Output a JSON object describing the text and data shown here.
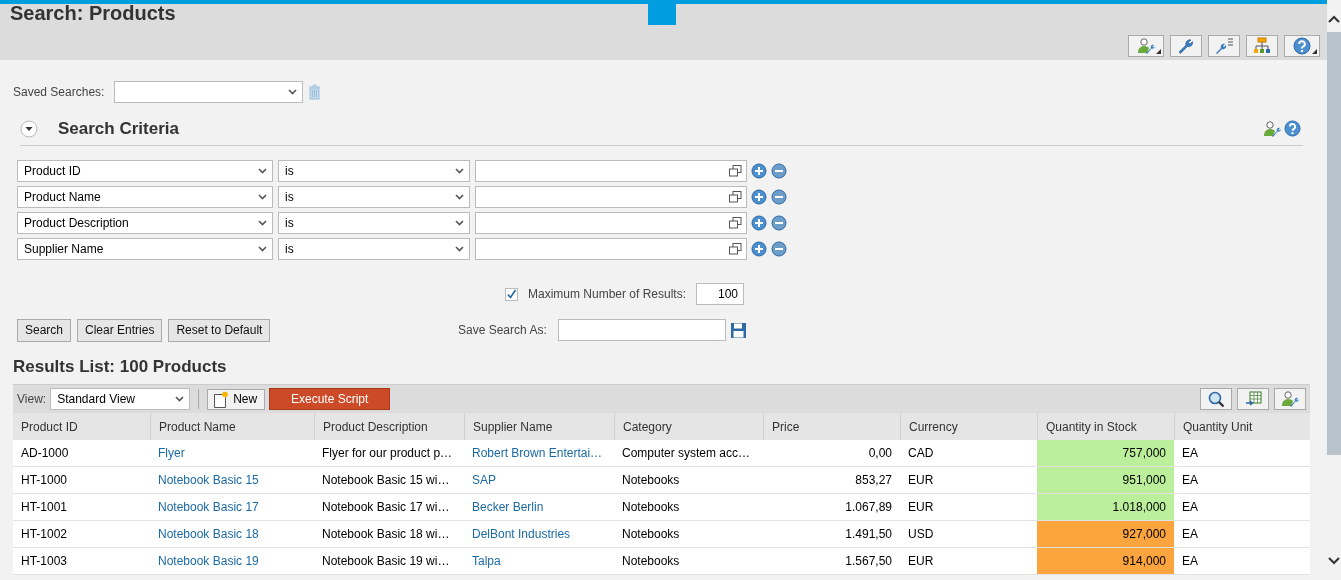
{
  "header": {
    "title": "Search: Products"
  },
  "saved_searches": {
    "label": "Saved Searches:"
  },
  "criteria": {
    "title": "Search Criteria",
    "expanded": true,
    "rows": [
      {
        "field": "Product ID",
        "operator": "is"
      },
      {
        "field": "Product Name",
        "operator": "is"
      },
      {
        "field": "Product Description",
        "operator": "is"
      },
      {
        "field": "Supplier Name",
        "operator": "is"
      }
    ]
  },
  "max_results": {
    "checked": true,
    "label": "Maximum Number of Results:",
    "value": "100"
  },
  "buttons": [
    "Search",
    "Clear Entries",
    "Reset to Default"
  ],
  "save_search": {
    "label": "Save Search As:"
  },
  "results": {
    "title": "Results List: 100 Products",
    "view_label": "View:",
    "view": "Standard View",
    "new_button": "New",
    "script_button": "Execute Script",
    "columns": [
      {
        "label": "Product ID",
        "kind": "text"
      },
      {
        "label": "Product Name",
        "kind": "link"
      },
      {
        "label": "Product Description",
        "kind": "text"
      },
      {
        "label": "Supplier Name",
        "kind": "link"
      },
      {
        "label": "Category",
        "kind": "text"
      },
      {
        "label": "Price",
        "kind": "number"
      },
      {
        "label": "Currency",
        "kind": "text"
      },
      {
        "label": "Quantity in Stock",
        "kind": "stock"
      },
      {
        "label": "Quantity Unit",
        "kind": "text"
      }
    ],
    "rows": [
      {
        "cells": [
          "AD-1000",
          "Flyer",
          "Flyer for our product p…",
          "Robert Brown Entertai…",
          "Computer system acc…",
          "0,00",
          "CAD",
          "757,000",
          "EA"
        ],
        "color": "#bbef9b"
      },
      {
        "cells": [
          "HT-1000",
          "Notebook Basic 15",
          "Notebook Basic 15 wi…",
          "SAP",
          "Notebooks",
          "853,27",
          "EUR",
          "951,000",
          "EA"
        ],
        "color": "#bbef9b"
      },
      {
        "cells": [
          "HT-1001",
          "Notebook Basic 17",
          "Notebook Basic 17 wi…",
          "Becker Berlin",
          "Notebooks",
          "1.067,89",
          "EUR",
          "1.018,000",
          "EA"
        ],
        "color": "#bbef9b"
      },
      {
        "cells": [
          "HT-1002",
          "Notebook Basic 18",
          "Notebook Basic 18 wi…",
          "DelBont Industries",
          "Notebooks",
          "1.491,50",
          "USD",
          "927,000",
          "EA"
        ],
        "color": "#fca43e"
      },
      {
        "cells": [
          "HT-1003",
          "Notebook Basic 19",
          "Notebook Basic 19 wi…",
          "Talpa",
          "Notebooks",
          "1.567,50",
          "EUR",
          "914,000",
          "EA"
        ],
        "color": "#fca43e"
      }
    ]
  }
}
